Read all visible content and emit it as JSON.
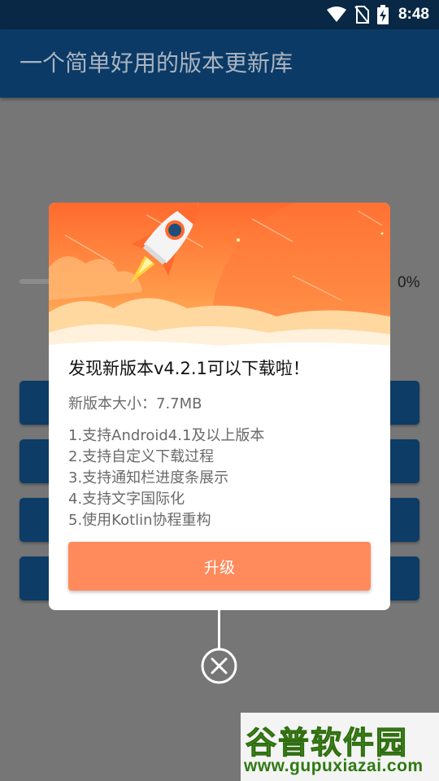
{
  "status_bar": {
    "time": "8:48",
    "icons": [
      "wifi-icon",
      "no-sim-icon",
      "battery-charging-icon"
    ]
  },
  "app_bar": {
    "title": "一个简单好用的版本更新库"
  },
  "background": {
    "progress_percent_label": "0%",
    "progress_value": 0,
    "buttons": [
      "",
      "",
      "",
      ""
    ]
  },
  "dialog": {
    "title": "发现新版本v4.2.1可以下载啦！",
    "size_text": "新版本大小：7.7MB",
    "notes": [
      "1.支持Android4.1及以上版本",
      "2.支持自定义下载过程",
      "3.支持通知栏进度条展示",
      "4.支持文字国际化",
      "5.使用Kotlin协程重构"
    ],
    "upgrade_label": "升级",
    "header_colors": {
      "top": "#ff6a2e",
      "bottom": "#ffc978",
      "rocket_window": "#1f4f78"
    }
  },
  "watermark": {
    "logo_text": "谷普软件园",
    "url": "www.gupuxiazai.com"
  }
}
